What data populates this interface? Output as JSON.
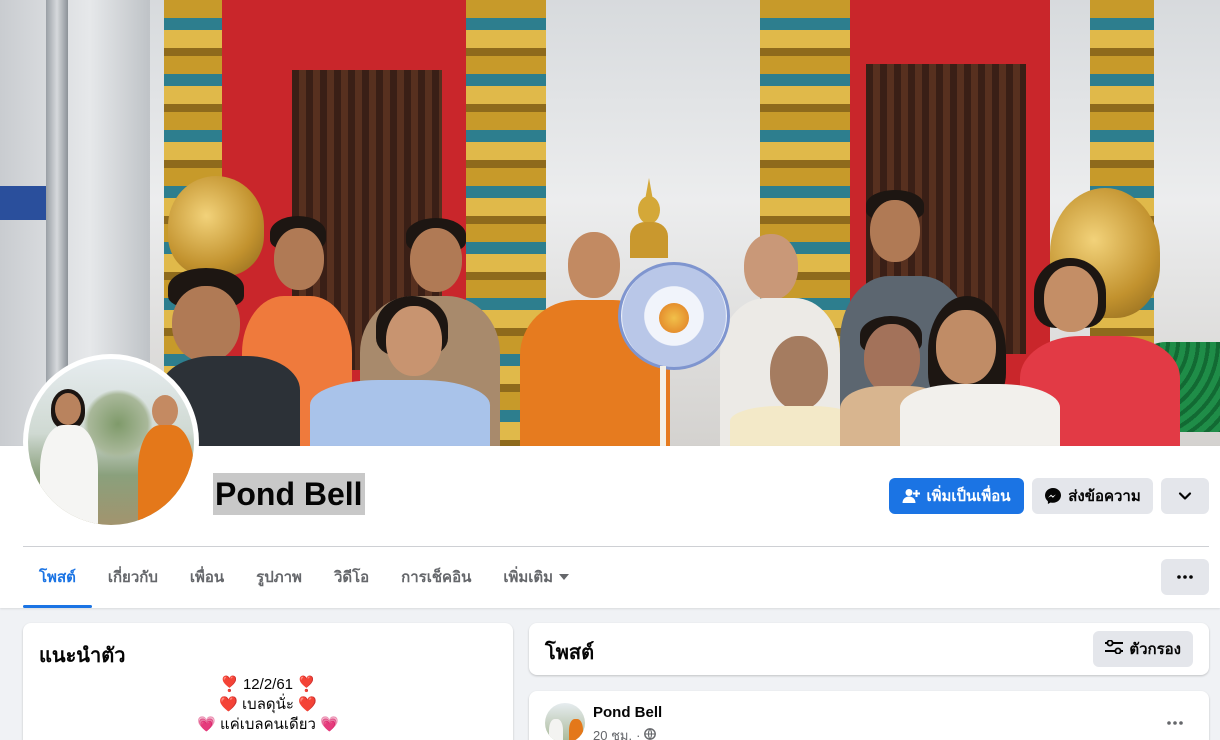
{
  "profile": {
    "name": "Pond Bell",
    "cover_alt": "cover-photo-temple-group",
    "avatar_alt": "profile-photo"
  },
  "actions": {
    "add_friend_label": "เพิ่มเป็นเพื่อน",
    "message_label": "ส่งข้อความ",
    "add_friend_icon": "add-person-icon",
    "message_icon": "messenger-icon",
    "expand_icon": "chevron-down-icon"
  },
  "tabs": [
    {
      "label": "โพสต์",
      "active": true
    },
    {
      "label": "เกี่ยวกับ",
      "active": false
    },
    {
      "label": "เพื่อน",
      "active": false
    },
    {
      "label": "รูปภาพ",
      "active": false
    },
    {
      "label": "วิดีโอ",
      "active": false
    },
    {
      "label": "การเช็คอิน",
      "active": false
    },
    {
      "label": "เพิ่มเติม",
      "active": false
    }
  ],
  "intro": {
    "title": "แนะนำตัว",
    "bio_lines": [
      "❣️ 12/2/61 ❣️",
      "❤️ เบลดุนั่ะ ❤️",
      "💗 แค่เบลคนเดียว 💗"
    ]
  },
  "posts_header": {
    "title": "โพสต์",
    "filter_label": "ตัวกรอง",
    "filter_icon": "filter-sliders-icon"
  },
  "post": {
    "author": "Pond Bell",
    "time": "20 ชม.",
    "separator": "·",
    "privacy_icon": "globe-icon"
  },
  "colors": {
    "accent": "#1b74e4",
    "background": "#f0f2f5",
    "secondary_button": "#e4e6eb",
    "muted_text": "#65676b"
  }
}
